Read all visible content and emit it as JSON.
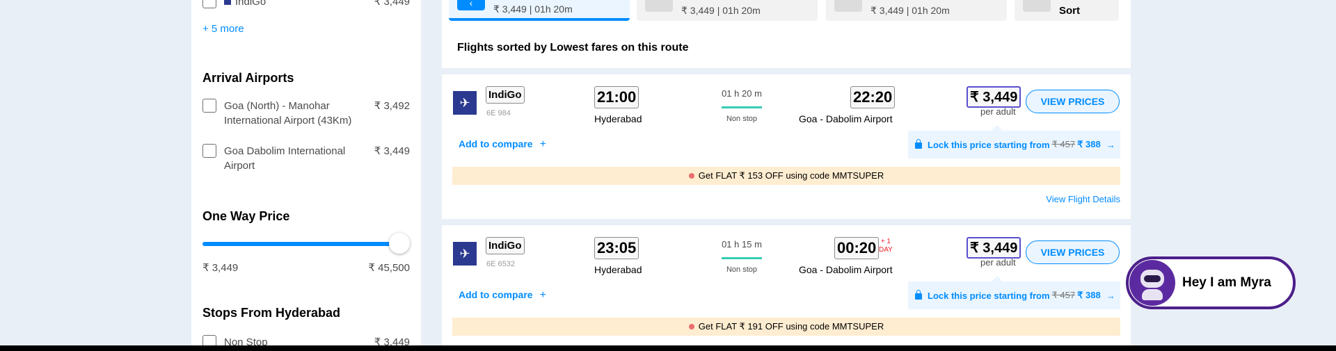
{
  "sidebar": {
    "top_item": {
      "label": "IndiGo",
      "price": "₹ 3,449"
    },
    "more_link": "+ 5 more",
    "arrival": {
      "heading": "Arrival Airports",
      "items": [
        {
          "label": "Goa (North) - Manohar International Airport (43Km)",
          "price": "₹ 3,492"
        },
        {
          "label": "Goa Dabolim International Airport",
          "price": "₹ 3,449"
        }
      ]
    },
    "price": {
      "heading": "One Way Price",
      "min": "₹ 3,449",
      "max": "₹ 45,500",
      "level": 1.0
    },
    "stops": {
      "heading": "Stops From Hyderabad",
      "items": [
        {
          "label": "Non Stop",
          "price": "₹ 3,449"
        }
      ]
    }
  },
  "tabs": [
    {
      "label": "₹ 3,449 | 01h 20m",
      "active": true
    },
    {
      "label": "₹ 3,449 | 01h 20m",
      "active": false
    },
    {
      "label": "₹ 3,449 | 01h 20m",
      "active": false
    },
    {
      "label": "Sort",
      "active": false
    }
  ],
  "sorted_title": "Flights sorted by Lowest fares on this route",
  "flights": [
    {
      "airline": "IndiGo",
      "flight_no": "6E 984",
      "dep_time": "21:00",
      "dep_city": "Hyderabad",
      "duration": "01 h 20 m",
      "stops": "Non stop",
      "arr_time": "22:20",
      "arr_city": "Goa - Dabolim Airport",
      "plus_day": "",
      "price": "₹ 3,449",
      "per_adult": "per adult",
      "view_label": "VIEW PRICES",
      "compare": "Add to compare",
      "lock": {
        "prefix": "Lock this price starting from",
        "old": "₹ 457",
        "new": "₹ 388",
        "arrow": "→"
      },
      "offer": "Get FLAT ₹ 153 OFF using code MMTSUPER",
      "details": "View Flight Details"
    },
    {
      "airline": "IndiGo",
      "flight_no": "6E 6532",
      "dep_time": "23:05",
      "dep_city": "Hyderabad",
      "duration": "01 h 15 m",
      "stops": "Non stop",
      "arr_time": "00:20",
      "arr_city": "Goa - Dabolim Airport",
      "plus_day": "+ 1",
      "plus_day_label": "DAY",
      "price": "₹ 3,449",
      "per_adult": "per adult",
      "view_label": "VIEW PRICES",
      "compare": "Add to compare",
      "lock": {
        "prefix": "Lock this price starting from",
        "old": "₹ 457",
        "new": "₹ 388",
        "arrow": "→"
      },
      "offer": "Get FLAT ₹ 191 OFF using code MMTSUPER"
    }
  ],
  "myra": {
    "text": "Hey I am Myra"
  },
  "colors": {
    "accent": "#008cff",
    "brand_purple": "#4c1f8a",
    "offer_bg": "#ffedd1",
    "duration_green": "#36ccb3"
  }
}
